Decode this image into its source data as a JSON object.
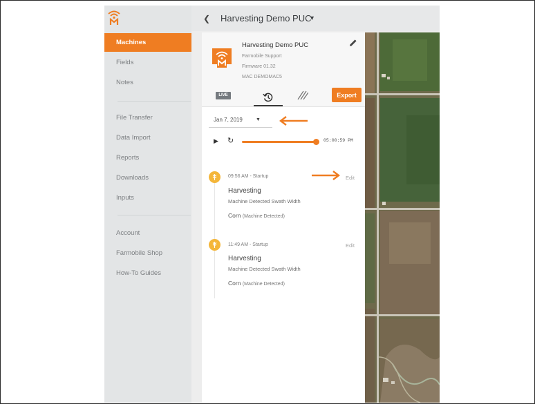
{
  "header": {
    "title": "Harvesting Demo PUC"
  },
  "sidebar": {
    "items": [
      {
        "label": "Machines",
        "active": true
      },
      {
        "label": "Fields"
      },
      {
        "label": "Notes"
      },
      {
        "label": "File Transfer"
      },
      {
        "label": "Data Import"
      },
      {
        "label": "Reports"
      },
      {
        "label": "Downloads"
      },
      {
        "label": "Inputs"
      },
      {
        "label": "Account"
      },
      {
        "label": "Farmobile Shop"
      },
      {
        "label": "How-To Guides"
      }
    ]
  },
  "machine": {
    "name": "Harvesting Demo PUC",
    "owner": "Farmobile Support",
    "firmware": "Firmware 01.32",
    "mac": "MAC DEMOMAC5"
  },
  "tabs": {
    "live_label": "LIVE",
    "export_label": "Export"
  },
  "date_select": {
    "value": "Jan 7, 2019"
  },
  "playback": {
    "time": "05:00:59 PM",
    "progress": 1.0
  },
  "events": [
    {
      "time": "09:56 AM - Startup",
      "edit": "Edit",
      "title": "Harvesting",
      "subtitle": "Machine Detected Swath Width",
      "crop": "Corn",
      "crop_note": "(Machine Detected)"
    },
    {
      "time": "11:49 AM - Startup",
      "edit": "Edit",
      "title": "Harvesting",
      "subtitle": "Machine Detected Swath Width",
      "crop": "Corn",
      "crop_note": "(Machine Detected)"
    }
  ],
  "colors": {
    "accent": "#ef7d22",
    "event_icon": "#f4b63a",
    "sidebar_bg": "#e3e5e6"
  }
}
